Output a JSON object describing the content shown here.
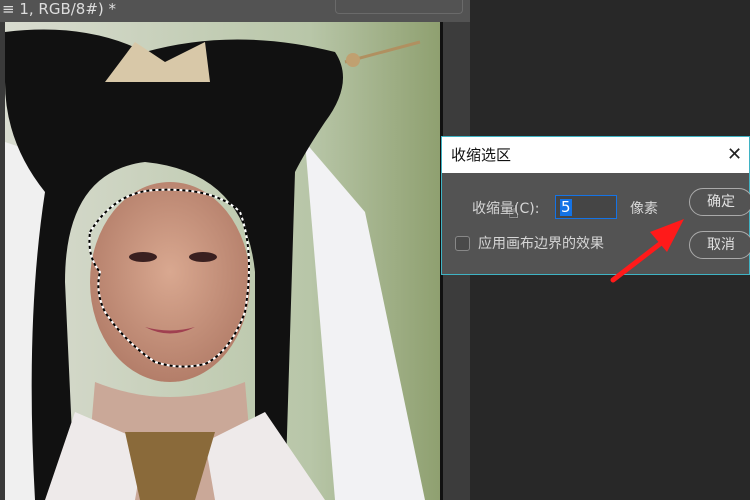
{
  "document_tab": {
    "title": "≡ 1, RGB/8#) *"
  },
  "dialog": {
    "title": "收缩选区",
    "close_icon": "close-icon",
    "contract_label": "收缩量(C):",
    "contract_value": "5",
    "unit": "像素",
    "checkbox_label": "应用画布边界的效果",
    "checkbox_checked": false,
    "ok_label": "确定",
    "cancel_label": "取消"
  },
  "colors": {
    "accent": "#1473e6",
    "dialog_border": "#3fb3c4",
    "arrow": "#ff1a1a"
  }
}
